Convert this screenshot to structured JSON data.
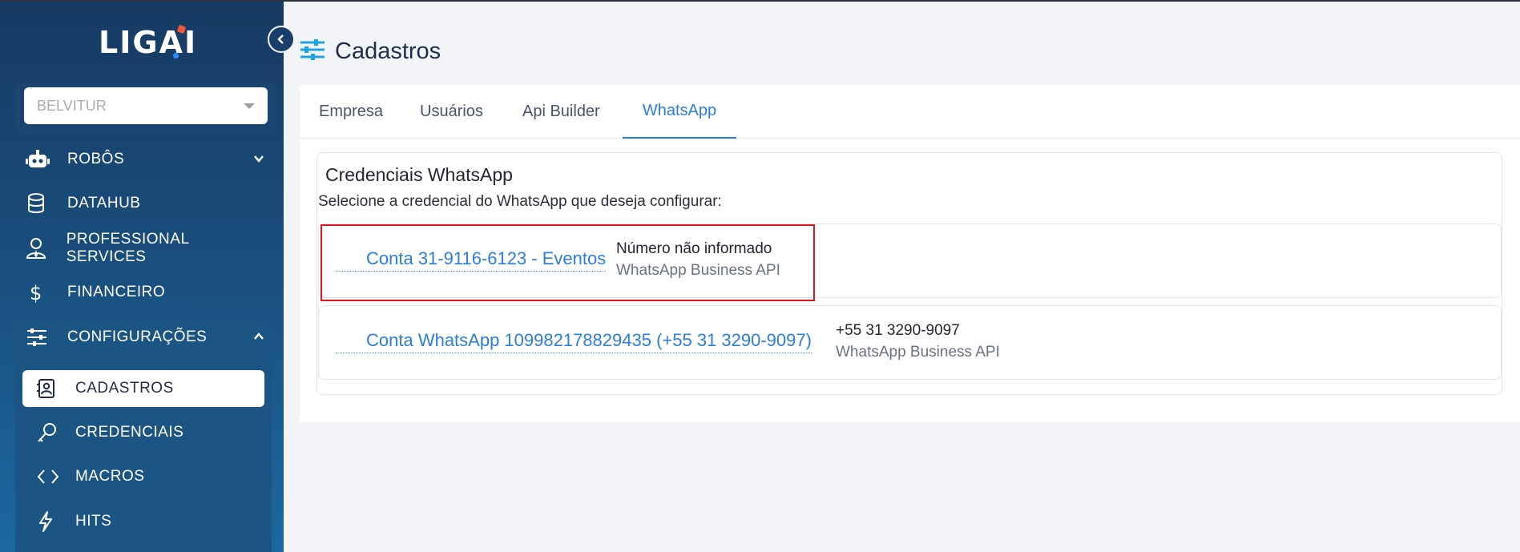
{
  "app": {
    "logo_text": "LIGAI"
  },
  "sidebar": {
    "org_select": {
      "value": "BELVITUR"
    },
    "items": [
      {
        "label": "ROBÔS",
        "icon": "robot-icon"
      },
      {
        "label": "DATAHUB",
        "icon": "database-icon"
      },
      {
        "label": "PROFESSIONAL SERVICES",
        "icon": "user-tie-icon"
      },
      {
        "label": "FINANCEIRO",
        "icon": "dollar-icon"
      },
      {
        "label": "CONFIGURAÇÕES",
        "icon": "sliders-icon"
      }
    ],
    "config_sub_items": [
      {
        "label": "CADASTROS",
        "icon": "contact-card-icon",
        "active": true
      },
      {
        "label": "CREDENCIAIS",
        "icon": "key-icon"
      },
      {
        "label": "MACROS",
        "icon": "code-icon"
      },
      {
        "label": "HITS",
        "icon": "bolt-icon"
      }
    ]
  },
  "page": {
    "title": "Cadastros"
  },
  "tabs": [
    {
      "label": "Empresa"
    },
    {
      "label": "Usuários"
    },
    {
      "label": "Api Builder"
    },
    {
      "label": "WhatsApp",
      "active": true
    }
  ],
  "panel": {
    "title": "Credenciais WhatsApp",
    "subtitle": "Selecione a credencial do WhatsApp que deseja configurar:"
  },
  "credentials": [
    {
      "name": "Conta 31-9116-6123 - Eventos",
      "number": "Número não informado",
      "type": "WhatsApp Business API",
      "highlighted": true
    },
    {
      "name": "Conta WhatsApp 109982178829435 (+55 31 3290-9097)",
      "number": "+55 31 3290-9097",
      "type": "WhatsApp Business API"
    }
  ],
  "colors": {
    "accent": "#2a7de1",
    "sidebar_top": "#173a62",
    "sidebar_bottom": "#1b68a0",
    "highlight": "#e0141a"
  }
}
